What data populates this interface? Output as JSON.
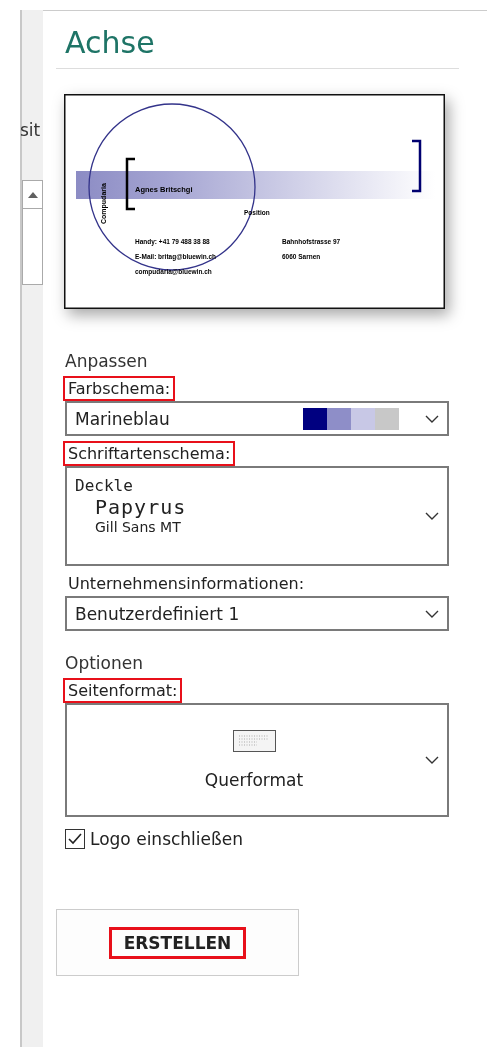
{
  "sidebar_fragment": {
    "text": "sit"
  },
  "title": "Achse",
  "preview": {
    "company": "Compudaria",
    "name": "Agnes Britschgi",
    "position": "Position",
    "contact_lines": [
      "Handy: +41 79 488 38 88",
      "E-Mail: britag@bluewin.ch",
      "compudaria@bluewin.ch"
    ],
    "address_lines": [
      "Bahnhofstrasse 97",
      "6060 Sarnen"
    ]
  },
  "customize": {
    "heading": "Anpassen",
    "color_scheme": {
      "label": "Farbschema:",
      "highlighted": true,
      "value": "Marineblau",
      "swatches": [
        {
          "color": "#000080"
        },
        {
          "color": "#8e8ec8"
        },
        {
          "color": "#c8c8e6"
        },
        {
          "color": "#c8c8c8"
        }
      ]
    },
    "font_scheme": {
      "label": "Schriftartenschema:",
      "highlighted": true,
      "heading_font": "Deckle",
      "body_font": "Papyrus",
      "detail_font": "Gill Sans MT"
    },
    "company_info": {
      "label": "Unternehmensinformationen:",
      "highlighted": false,
      "value": "Benutzerdefiniert 1"
    }
  },
  "options": {
    "heading": "Optionen",
    "page_format": {
      "label": "Seitenformat:",
      "highlighted": true,
      "value": "Querformat"
    },
    "include_logo": {
      "label": "Logo einschließen",
      "checked": true
    }
  },
  "create_button": {
    "label": "ERSTELLEN",
    "highlighted": true
  }
}
